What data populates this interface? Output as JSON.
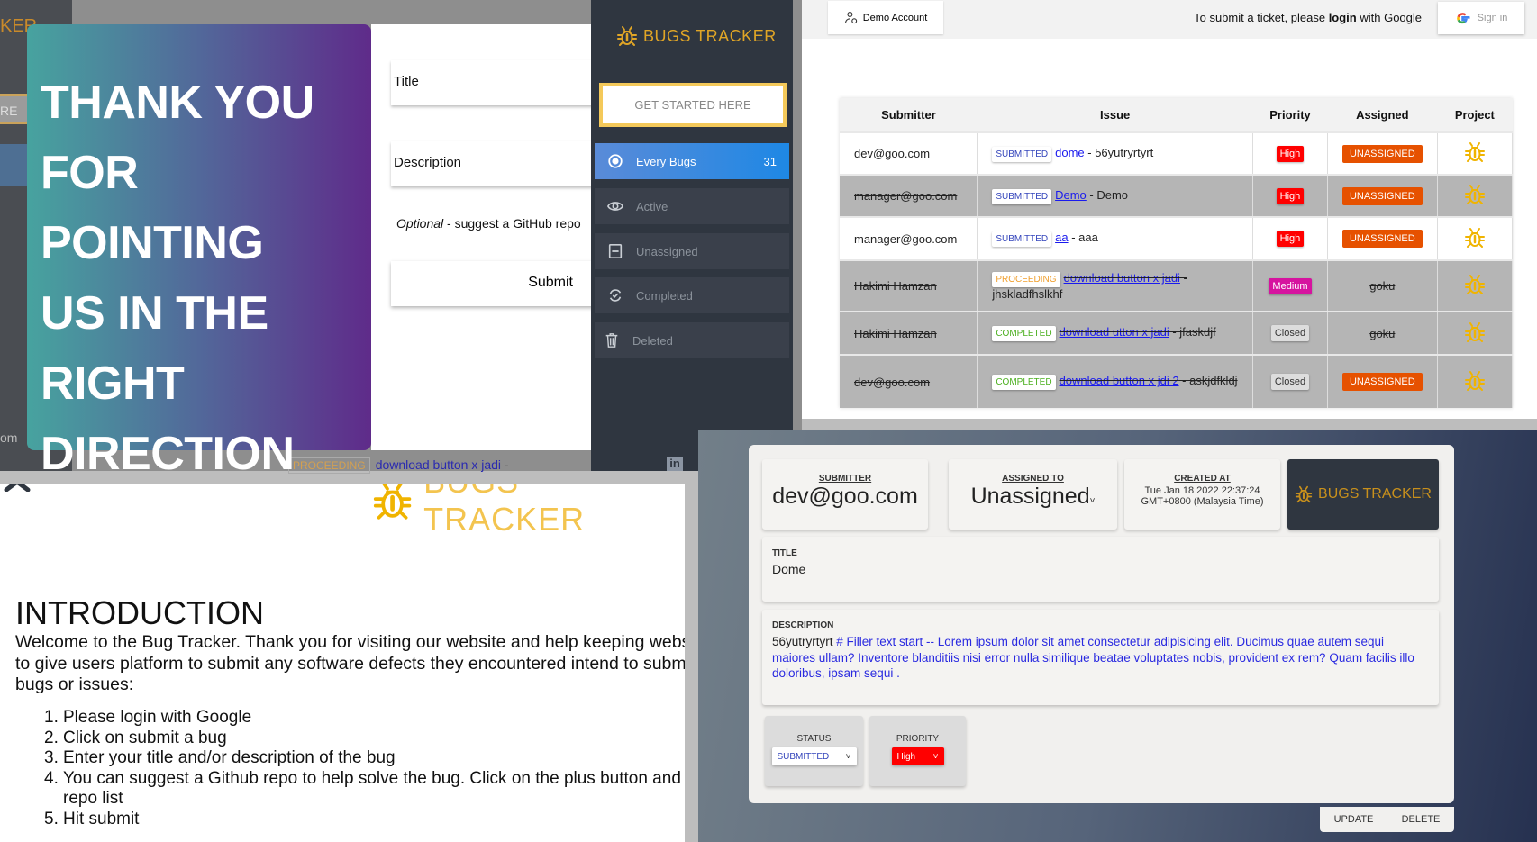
{
  "background_app": {
    "logo_fragment": "KER",
    "button_fragment": "RE",
    "email_fragment": "om",
    "row_fragment": {
      "status": "PROCEEDING",
      "link": "download button x jadi",
      "suffix": " -"
    }
  },
  "thank_you": {
    "lines": [
      "THANK YOU",
      "FOR POINTING",
      "US IN THE",
      "RIGHT",
      "DIRECTION"
    ]
  },
  "submit_form": {
    "title_placeholder": "Title",
    "description_placeholder": "Description",
    "optional_label": "Optional",
    "optional_text": " - suggest a GitHub repo",
    "submit_label": "Submit"
  },
  "sidebar": {
    "brand": "BUGS TRACKER",
    "get_started": "GET STARTED HERE",
    "items": [
      {
        "label": "Every Bugs",
        "count": "31",
        "icon": "radio-icon",
        "active": true
      },
      {
        "label": "Active",
        "icon": "eye-icon"
      },
      {
        "label": "Unassigned",
        "icon": "minus-box-icon"
      },
      {
        "label": "Completed",
        "icon": "refresh-check-icon"
      },
      {
        "label": "Deleted",
        "icon": "trash-icon"
      }
    ],
    "linkedin": "in"
  },
  "bug_list": {
    "demo_account": "Demo Account",
    "login_msg_pre": "To submit a ticket, please ",
    "login_msg_bold": "login",
    "login_msg_post": " with Google",
    "sign_in": "Sign in",
    "columns": [
      "Submitter",
      "Issue",
      "Priority",
      "Assigned",
      "Project"
    ],
    "rows": [
      {
        "submitter": "dev@goo.com",
        "status": "SUBMITTED",
        "link": "dome",
        "desc": " - 56yutryrtyrt",
        "priority": "High",
        "assigned": "UNASSIGNED",
        "struck": false
      },
      {
        "submitter": "manager@goo.com",
        "status": "SUBMITTED",
        "link": "Demo",
        "desc": " - Demo",
        "priority": "High",
        "assigned": "UNASSIGNED",
        "struck": true
      },
      {
        "submitter": "manager@goo.com",
        "status": "SUBMITTED",
        "link": "aa",
        "desc": " - aaa",
        "priority": "High",
        "assigned": "UNASSIGNED",
        "struck": false
      },
      {
        "submitter": "Hakimi Hamzan",
        "status": "PROCEEDING",
        "link": "download button x jadi",
        "desc": " - jhskladfhslkhf",
        "priority": "Medium",
        "assigned": "goku",
        "struck": true
      },
      {
        "submitter": "Hakimi Hamzan",
        "status": "COMPLETED",
        "link": "download utton x jadi",
        "desc": " - jfaskdjf",
        "priority": "Closed",
        "assigned": "goku",
        "struck": true
      },
      {
        "submitter": "dev@goo.com",
        "status": "COMPLETED",
        "link": "download button x jdi 2",
        "desc": " - askjdfkldj",
        "priority": "Closed",
        "assigned": "UNASSIGNED",
        "struck": true
      }
    ]
  },
  "intro": {
    "brand": "BUGS TRACKER",
    "heading": "INTRODUCTION",
    "paragraph": "Welcome to the Bug Tracker. Thank you for visiting our website and help keeping website is to give users platform to submit any software defects they encountered intend to submit bugs or issues:",
    "steps": [
      "Please login with Google",
      "Click on submit a bug",
      "Enter your title and/or description of the bug",
      "You can suggest a Github repo to help solve the bug. Click on the plus button and repo list",
      "Hit submit"
    ]
  },
  "bug_detail": {
    "submitter_label": "SUBMITTER",
    "submitter": "dev@goo.com",
    "assigned_label": "ASSIGNED TO",
    "assigned": "Unassigned",
    "created_label": "CREATED AT",
    "created_line1": "Tue  Jan  18  2022  22:37:24",
    "created_line2": "GMT+0800 (Malaysia Time)",
    "brand": "BUGS TRACKER",
    "title_label": "TITLE",
    "title": "Dome",
    "description_label": "DESCRIPTION",
    "description_plain": "56yutryrtyrt ",
    "description_link": "# Filler text start -- Lorem ipsum dolor sit amet consectetur adipisicing elit. Ducimus quae autem sequi maiores ullam? Inventore blanditiis nisi error nulla similique beatae voluptates nobis, provident ex rem? Quam facilis illo doloribus, ipsam sequi .",
    "status_label": "STATUS",
    "status": "SUBMITTED",
    "priority_label": "PRIORITY",
    "priority": "High",
    "update": "UPDATE",
    "delete": "DELETE"
  },
  "colors": {
    "brand_gold": "#e0a526",
    "sidebar_bg": "#2f3640",
    "active_blue": "#1e88e5",
    "high": "#ff0000",
    "medium": "#d6139f",
    "closed": "#dddddd",
    "unassigned": "#e65100",
    "submitted": "#3344bb",
    "proceeding": "#f0a030",
    "completed": "#4caf20"
  }
}
